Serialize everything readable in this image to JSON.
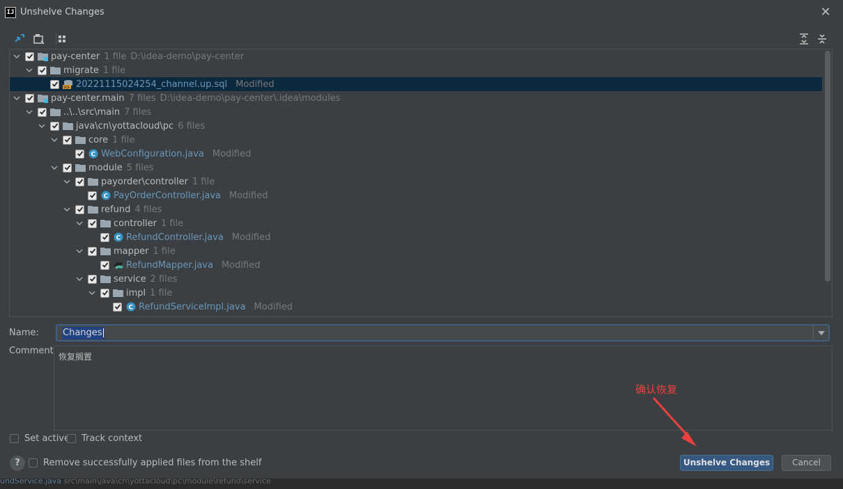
{
  "window": {
    "title": "Unshelve Changes",
    "app_icon": "IJ"
  },
  "tree": [
    {
      "name": "pay-center",
      "count": "1 file",
      "path": "D:\\idea-demo\\pay-center",
      "kind": "module"
    },
    {
      "name": "migrate",
      "count": "1 file",
      "kind": "folder"
    },
    {
      "name": "20221115024254_channel.up.sql",
      "status": "Modified",
      "kind": "sql"
    },
    {
      "name": "pay-center.main",
      "count": "7 files",
      "path": "D:\\idea-demo\\pay-center\\.idea\\modules",
      "kind": "module"
    },
    {
      "name": "..\\..\\src\\main",
      "count": "7 files",
      "kind": "folder"
    },
    {
      "name": "java\\cn\\yottacloud\\pc",
      "count": "6 files",
      "kind": "folder"
    },
    {
      "name": "core",
      "count": "1 file",
      "kind": "folder"
    },
    {
      "name": "WebConfiguration.java",
      "status": "Modified",
      "kind": "class"
    },
    {
      "name": "module",
      "count": "5 files",
      "kind": "folder"
    },
    {
      "name": "payorder\\controller",
      "count": "1 file",
      "kind": "folder"
    },
    {
      "name": "PayOrderController.java",
      "status": "Modified",
      "kind": "class"
    },
    {
      "name": "refund",
      "count": "4 files",
      "kind": "folder"
    },
    {
      "name": "controller",
      "count": "1 file",
      "kind": "folder"
    },
    {
      "name": "RefundController.java",
      "status": "Modified",
      "kind": "class"
    },
    {
      "name": "mapper",
      "count": "1 file",
      "kind": "folder"
    },
    {
      "name": "RefundMapper.java",
      "status": "Modified",
      "kind": "mapper"
    },
    {
      "name": "service",
      "count": "2 files",
      "kind": "folder"
    },
    {
      "name": "impl",
      "count": "1 file",
      "kind": "folder"
    },
    {
      "name": "RefundServiceImpl.java",
      "status": "Modified",
      "kind": "class"
    }
  ],
  "form": {
    "name_label": "Name:",
    "name_value": "Changes",
    "comment_label": "Comment:",
    "comment_value": "恢复搁置"
  },
  "options": {
    "set_active": "Set active",
    "track_context": "Track context",
    "remove_applied": "Remove successfully applied files from the shelf"
  },
  "buttons": {
    "help": "?",
    "unshelve": "Unshelve Changes",
    "cancel": "Cancel"
  },
  "annotation": {
    "text": "确认恢复",
    "color": "#e8413e"
  },
  "background": {
    "line1_file": "undService.java",
    "line1_path": "src\\main\\java\\cn\\yottacloud\\pc\\module\\refund\\service"
  },
  "colors": {
    "dialog_bg": "#3c3f41",
    "selection": "#0d293e",
    "primary_button": "#365880",
    "file_link": "#6897bb"
  }
}
